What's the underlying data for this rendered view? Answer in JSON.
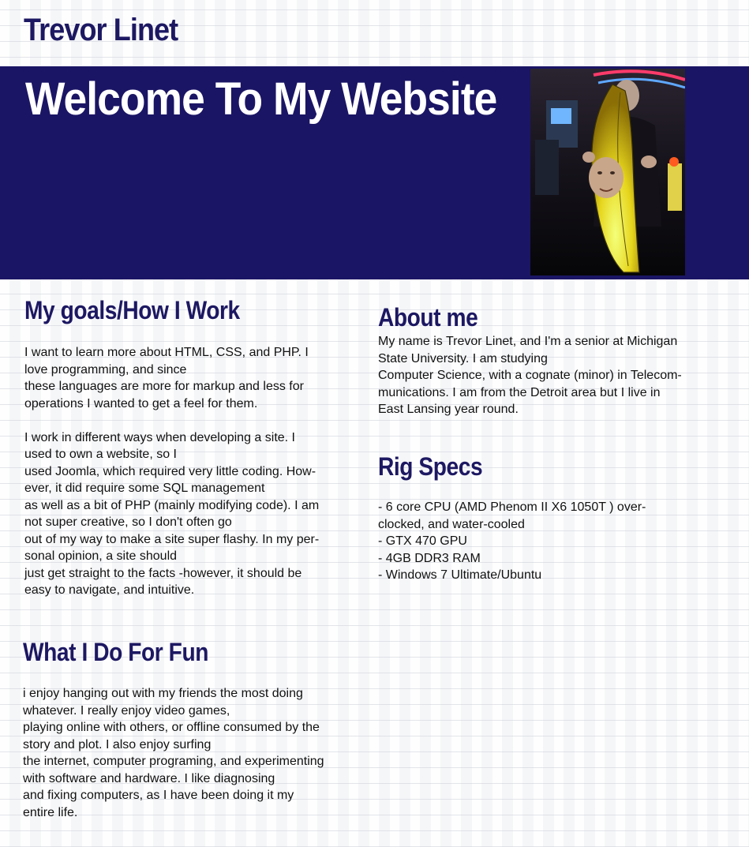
{
  "site_name": "Trevor Linet",
  "hero": {
    "title": "Welcome To My Website",
    "photo_icon": "portrait-photo-banana-costume"
  },
  "goals": {
    "heading": "My goals/How I Work",
    "paragraph1": [
      "I want to learn more about HTML, CSS, and PHP. I",
      "love programming, and since",
      "these languages are more for markup and less for",
      "operations I wanted to get a feel for them."
    ],
    "paragraph2": [
      "I work in different ways when developing a site. I",
      "used to own a website, so I",
      "used Joomla, which required very little coding. How-",
      "ever, it did require some SQL management",
      "as well as a bit of PHP (mainly modifying code). I am",
      "not super creative, so I don't often go",
      "out of my way to make a site super flashy. In my per-",
      "sonal opinion, a site should",
      "just get straight to the facts -however, it should be",
      "easy to navigate, and intuitive."
    ]
  },
  "fun": {
    "heading": "What I Do For Fun",
    "lines": [
      "i enjoy hanging out with my friends the most doing",
      "whatever. I really enjoy video games,",
      "playing online with others, or offline consumed by the",
      "story and plot. I also enjoy surfing",
      "the internet, computer programing, and experimenting",
      "with software and hardware. I like diagnosing",
      "and fixing computers, as I have been doing it my",
      "entire life."
    ]
  },
  "about": {
    "heading": "About me",
    "lines": [
      "My name is Trevor Linet, and I'm a senior at Michigan",
      "State University. I am studying",
      "Computer Science, with a cognate (minor) in Telecom-",
      "munications. I am from the Detroit area but I live in",
      "East Lansing year round."
    ]
  },
  "rig": {
    "heading": "Rig Specs",
    "lines": [
      "- 6 core CPU (AMD Phenom II X6 1050T ) over-",
      "clocked, and water-cooled",
      "- GTX 470 GPU",
      "- 4GB DDR3 RAM",
      "- Windows 7 Ultimate/Ubuntu"
    ]
  },
  "colors": {
    "brand_navy": "#1b1565",
    "heading_navy": "#1d1862",
    "hero_text": "#ffffff"
  }
}
